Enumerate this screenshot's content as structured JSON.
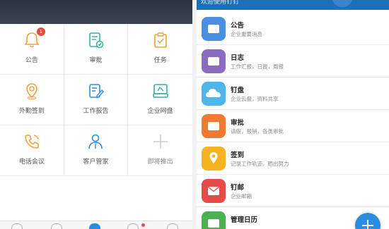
{
  "left": {
    "grid": [
      {
        "label": "公告",
        "icon": "bell-icon",
        "color": "#f0a23b",
        "badge": "1"
      },
      {
        "label": "审批",
        "icon": "approval-doc-icon",
        "color": "#2fb3a0"
      },
      {
        "label": "任务",
        "icon": "clipboard-check-icon",
        "color": "#f0a23b"
      },
      {
        "label": "外勤签到",
        "icon": "location-pin-icon",
        "color": "#f0a23b"
      },
      {
        "label": "工作报告",
        "icon": "report-edit-icon",
        "color": "#2a8de2"
      },
      {
        "label": "企业网盘",
        "icon": "drive-box-icon",
        "color": "#2fb3a0"
      },
      {
        "label": "电话会议",
        "icon": "phone-call-icon",
        "color": "#f0a23b"
      },
      {
        "label": "客户管家",
        "icon": "customer-user-icon",
        "color": "#2a8de2"
      },
      {
        "label": "即将推出",
        "icon": "plus-icon",
        "color": "#cccccc"
      }
    ]
  },
  "right": {
    "header_title": "欢迎使用钉钉",
    "items": [
      {
        "title": "公告",
        "subtitle": "企业重要消息",
        "icon": "announcement-icon",
        "color": "#4a8fe0"
      },
      {
        "title": "日志",
        "subtitle": "工作汇报，日报，周报",
        "icon": "log-icon",
        "color": "#8a6bbf"
      },
      {
        "title": "钉盘",
        "subtitle": "企业云盘，资料共享",
        "icon": "cloud-drive-icon",
        "color": "#4fb6ea"
      },
      {
        "title": "审批",
        "subtitle": "请假，报销，各类审批",
        "icon": "approval-icon",
        "color": "#f07a32"
      },
      {
        "title": "签到",
        "subtitle": "记录工作轨迹，晒出努力",
        "icon": "checkin-pin-icon",
        "color": "#f5b41f"
      },
      {
        "title": "钉邮",
        "subtitle": "企业邮箱",
        "icon": "mail-icon",
        "color": "#e84a4a"
      },
      {
        "title": "管理日历",
        "subtitle": "",
        "icon": "calendar-icon",
        "color": "#4caf50"
      }
    ],
    "fab": {
      "icon": "plus-icon"
    }
  }
}
